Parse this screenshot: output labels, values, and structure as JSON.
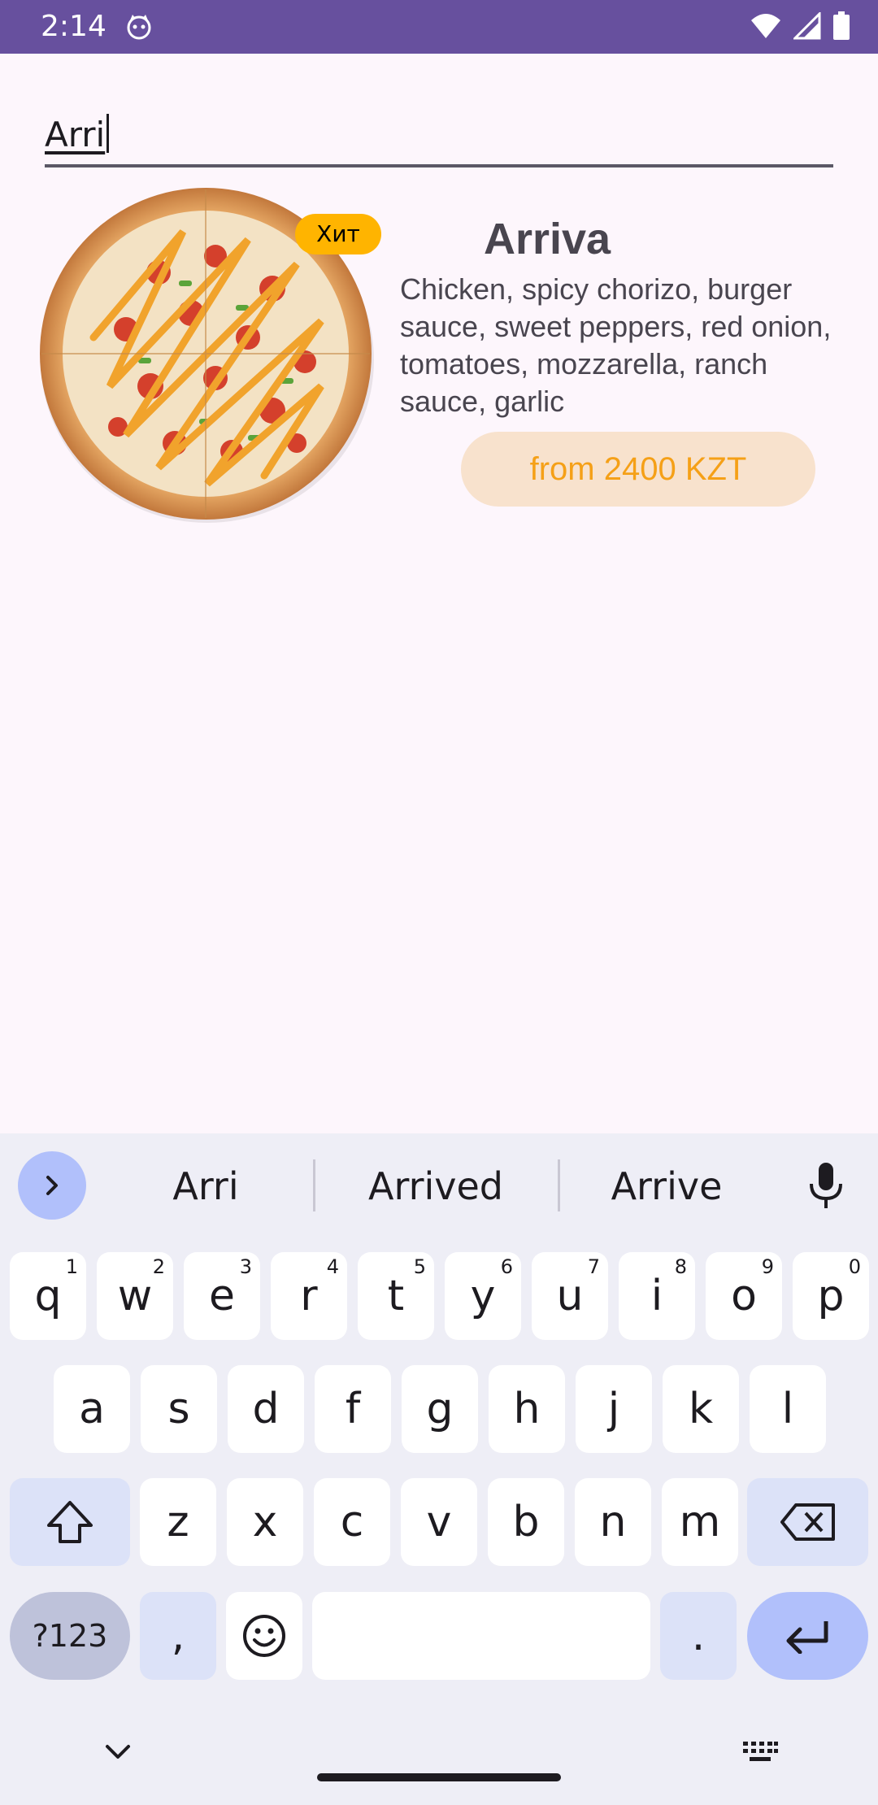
{
  "status_bar": {
    "time": "2:14",
    "app_icon": "cat-face-icon",
    "icons": [
      "wifi-icon",
      "cellular-signal-icon",
      "battery-icon"
    ],
    "background": "#67509e"
  },
  "search": {
    "value": "Arri"
  },
  "product": {
    "image": "pizza-image",
    "badge": "Хит",
    "title": "Arriva",
    "description": "Chicken, spicy chorizo, burger sauce, sweet peppers, red onion, tomatoes, mozzarella, ranch sauce, garlic",
    "price_label": "from 2400 KZT",
    "colors": {
      "price_bg": "#f8e2cd",
      "price_text": "#f5a017",
      "badge": "#ffb400"
    }
  },
  "keyboard": {
    "suggestions": [
      "Arri",
      "Arrived",
      "Arrive"
    ],
    "row1": [
      {
        "k": "q",
        "h": "1"
      },
      {
        "k": "w",
        "h": "2"
      },
      {
        "k": "e",
        "h": "3"
      },
      {
        "k": "r",
        "h": "4"
      },
      {
        "k": "t",
        "h": "5"
      },
      {
        "k": "y",
        "h": "6"
      },
      {
        "k": "u",
        "h": "7"
      },
      {
        "k": "i",
        "h": "8"
      },
      {
        "k": "o",
        "h": "9"
      },
      {
        "k": "p",
        "h": "0"
      }
    ],
    "row2": [
      "a",
      "s",
      "d",
      "f",
      "g",
      "h",
      "j",
      "k",
      "l"
    ],
    "row3": [
      "z",
      "x",
      "c",
      "v",
      "b",
      "n",
      "m"
    ],
    "symbols_label": "?123",
    "comma": ",",
    "period": ".",
    "icons": [
      "chevron-right-icon",
      "microphone-icon",
      "shift-icon",
      "backspace-icon",
      "emoji-icon",
      "enter-icon",
      "hide-keyboard-icon",
      "keyboard-switch-icon"
    ]
  }
}
